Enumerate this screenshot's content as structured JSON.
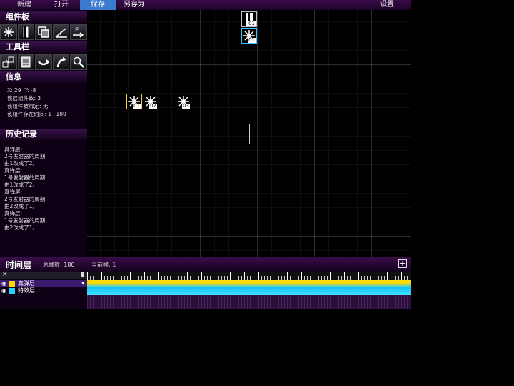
{
  "menu": {
    "new": "新建",
    "open": "打开",
    "save": "保存",
    "save_as": "另存为",
    "settings": "设置"
  },
  "panels": {
    "components": "组件板",
    "toolbar": "工具栏",
    "info": "信息",
    "history": "历史记录"
  },
  "component_icons": [
    "starburst-icon",
    "bar-emitter-icon",
    "copy-layers-icon",
    "angle-icon",
    "function-icon"
  ],
  "tool_icons": [
    "align-icon",
    "paste-icon",
    "undo-icon",
    "redo-icon",
    "zoom-icon"
  ],
  "info": {
    "coords": "X: 29  Y: -8",
    "line1": "该层组件数: 3",
    "line2": "该组件被绑定: 无",
    "line3": "该组件存在时间: 1~180"
  },
  "history": [
    "真弹层:",
    "2号发射器的周期",
    "由1改成了2。",
    "真弹层:",
    "1号发射器的周期",
    "由1改成了2。",
    "真弹层:",
    "2号发射器的周期",
    "由2改成了1。",
    "真弹层:",
    "1号发射器的周期",
    "由2改成了1。"
  ],
  "stage_components": [
    {
      "label": "01",
      "kind": "bar"
    },
    {
      "label": "01",
      "kind": "star"
    },
    {
      "label": "01",
      "kind": "star"
    },
    {
      "label": "02",
      "kind": "star"
    },
    {
      "label": "03",
      "kind": "star"
    }
  ],
  "timeline": {
    "title": "时间层",
    "total_frames": "总帧数: 180",
    "current_frame": "当前帧: 1",
    "layers": [
      "真弹层",
      "特效层"
    ]
  },
  "colors": {
    "accent": "#3c7ad0",
    "panel": "#1c0326",
    "layer1": "#ffd700",
    "layer2": "#20d0ff"
  }
}
